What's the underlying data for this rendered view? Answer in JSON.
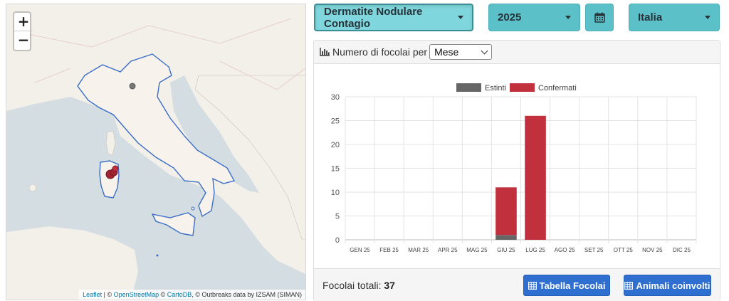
{
  "map": {
    "zoom_in": "+",
    "zoom_out": "−",
    "attribution": {
      "leaflet": "Leaflet",
      "sep1": " | © ",
      "osm": "OpenStreetMap",
      "sep2": " © ",
      "carto": "CartoDB",
      "rest": ", © Outbreaks data by IZSAM (SIMAN)"
    }
  },
  "controls": {
    "disease": "Dermatite Nodulare Contagio",
    "year": "2025",
    "country": "Italia",
    "calendar_icon": "calendar-icon"
  },
  "panel": {
    "title_prefix": "Numero di focolai per",
    "period_select": "Mese",
    "total_label": "Focolai totali:",
    "total_value": "37",
    "btn_table": "Tabella Focolai",
    "btn_animals": "Animali coinvolti"
  },
  "colors": {
    "estinti": "#666666",
    "confermati": "#c0313d",
    "button": "#2f6fd0",
    "dropdown": "#5bc0c8"
  },
  "chart_data": {
    "type": "bar",
    "stacked": true,
    "categories": [
      "GEN 25",
      "FEB 25",
      "MAR 25",
      "APR 25",
      "MAG 25",
      "GIU 25",
      "LUG 25",
      "AGO 25",
      "SET 25",
      "OTT 25",
      "NOV 25",
      "DIC 25"
    ],
    "series": [
      {
        "name": "Estinti",
        "values": [
          0,
          0,
          0,
          0,
          0,
          1,
          0,
          0,
          0,
          0,
          0,
          0
        ]
      },
      {
        "name": "Confermati",
        "values": [
          0,
          0,
          0,
          0,
          0,
          10,
          26,
          0,
          0,
          0,
          0,
          0
        ]
      }
    ],
    "ylim": [
      0,
      30
    ],
    "yticks": [
      0,
      5,
      10,
      15,
      20,
      25,
      30
    ],
    "legend_position": "top-center",
    "grid": true
  }
}
